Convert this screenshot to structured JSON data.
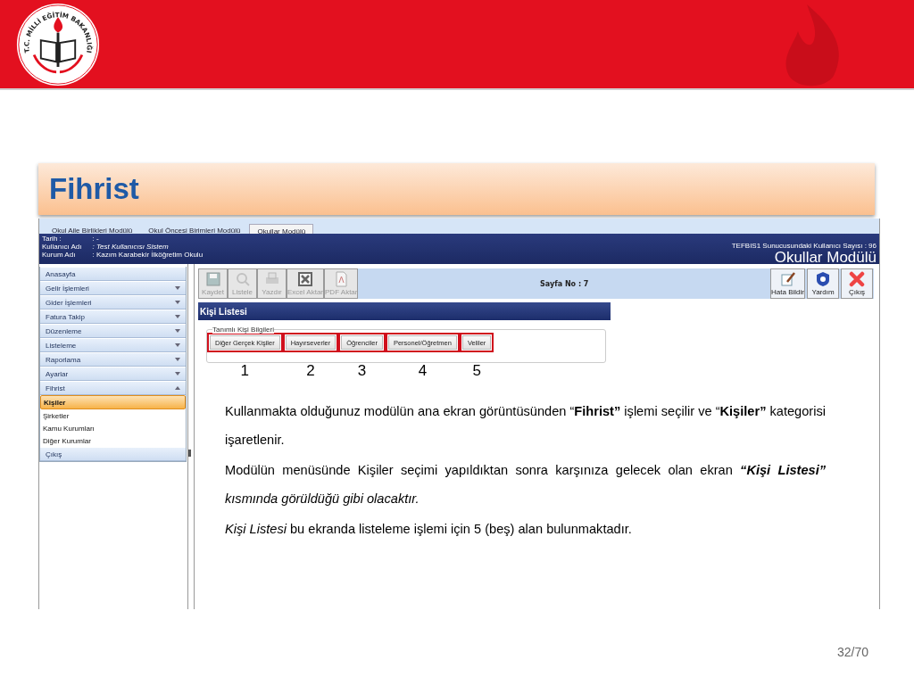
{
  "logo": {
    "text": "T.C. MİLLİ EĞİTİM BAKANLIĞI"
  },
  "title": "Fihrist",
  "app": {
    "tabs": [
      {
        "label": "Okul Aile Birlikleri Modülü",
        "selected": false
      },
      {
        "label": "Okul Öncesi Birimleri Modülü",
        "selected": false
      },
      {
        "label": "Okullar Modülü",
        "selected": true
      }
    ],
    "info": [
      {
        "label": "Tarih :",
        "value": ": -",
        "italic": false
      },
      {
        "label": "Kullanıcı Adı",
        "value": ": Test Kullanıcısı Sistem",
        "italic": true
      },
      {
        "label": "Kurum Adı",
        "value": ": Kazım Karabekir İlköğretim Okulu",
        "italic": false
      }
    ],
    "user_count": "TEFBIS1 Sunucusundaki Kullanıcı Sayısı : 96",
    "module_title": "Okullar Modülü",
    "sidebar": {
      "items": [
        {
          "label": "Anasayfa",
          "kind": "link"
        },
        {
          "label": "Gelir İşlemleri",
          "kind": "group",
          "expanded": false
        },
        {
          "label": "Gider İşlemleri",
          "kind": "group",
          "expanded": false
        },
        {
          "label": "Fatura Takip",
          "kind": "group",
          "expanded": false
        },
        {
          "label": "Düzenleme",
          "kind": "group",
          "expanded": false
        },
        {
          "label": "Listeleme",
          "kind": "group",
          "expanded": false
        },
        {
          "label": "Raporlama",
          "kind": "group",
          "expanded": false
        },
        {
          "label": "Ayarlar",
          "kind": "group",
          "expanded": false
        },
        {
          "label": "Fihrist",
          "kind": "group",
          "expanded": true,
          "children": [
            {
              "label": "Kişiler",
              "selected": true
            },
            {
              "label": "Şirketler",
              "selected": false
            },
            {
              "label": "Kamu Kurumları",
              "selected": false
            },
            {
              "label": "Diğer Kurumlar",
              "selected": false
            }
          ]
        },
        {
          "label": "Çıkış",
          "kind": "link"
        }
      ]
    },
    "toolbar": [
      {
        "label": "Kaydet",
        "kind": "save",
        "disabled": true
      },
      {
        "label": "Listele",
        "kind": "list",
        "disabled": true
      },
      {
        "label": "Yazdır",
        "kind": "print",
        "disabled": true
      },
      {
        "label": "Excel Aktar",
        "kind": "excel",
        "disabled": true
      },
      {
        "label": "PDF Aktar",
        "kind": "pdf",
        "disabled": true
      }
    ],
    "page_no": "Sayfa No : 7",
    "tools_right": [
      {
        "label": "Hata Bildir",
        "kind": "report"
      },
      {
        "label": "Yardım",
        "kind": "help"
      },
      {
        "label": "Çıkış",
        "kind": "exit"
      }
    ],
    "panel_title": "Kişi Listesi",
    "group_title": "Tanımlı Kişi Bilgileri",
    "buttons": [
      {
        "label": "Diğer Gerçek Kişiler",
        "highlighted": true,
        "callout": "1"
      },
      {
        "label": "Hayırseverler",
        "highlighted": true,
        "callout": "2"
      },
      {
        "label": "Öğrenciler",
        "highlighted": true,
        "callout": "3"
      },
      {
        "label": "Personel/Öğretmen",
        "highlighted": true,
        "callout": "4"
      },
      {
        "label": "Veliler",
        "highlighted": true,
        "callout": "5"
      }
    ]
  },
  "paragraphs": [
    {
      "kind": "plain",
      "text": "Kullanmakta olduğunuz modülün ana ekran görüntüsünden “**Fihrist”** işlemi seçilir ve “**Kişiler”** kategorisi işaretlenir."
    },
    {
      "kind": "emphasis",
      "text": "Modülün menüsünde Kişiler seçimi yapıldıktan sonra karşınıza gelecek olan ekran  **“Kişi Listesi”** *kısmında görüldüğü gibi olacaktır.*"
    },
    {
      "kind": "plain",
      "text": "*Kişi Listesi* bu ekranda listeleme işlemi için 5 (beş) alan bulunmaktadır."
    }
  ],
  "page_number": "32/70"
}
